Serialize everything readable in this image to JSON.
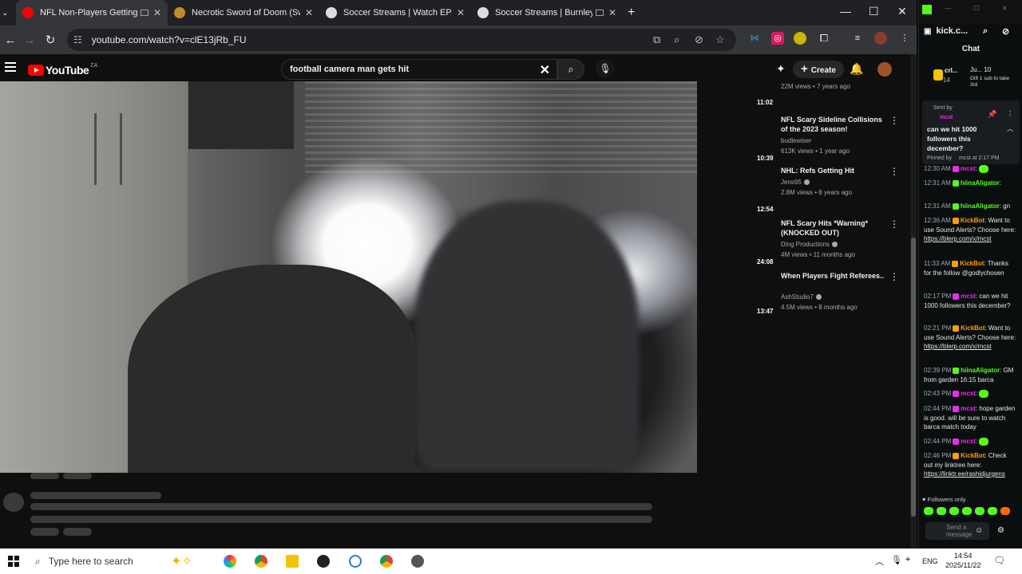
{
  "browser": {
    "tabs": [
      {
        "title": "NFL Non-Players Getting In",
        "active": true,
        "color": "#ff0000"
      },
      {
        "title": "Necrotic Sword of Doom (Swor",
        "active": false,
        "color": "#c28a2a"
      },
      {
        "title": "Soccer Streams | Watch EPL On",
        "active": false,
        "color": "#dddddd"
      },
      {
        "title": "Soccer Streams | Burnley vs",
        "active": false,
        "color": "#dddddd"
      }
    ],
    "url": "youtube.com/watch?v=clE13jRb_FU"
  },
  "youtube": {
    "logo_text": "YouTube",
    "logo_superscript": "ZA",
    "search_value": "football camera man gets hit",
    "create_label": "Create",
    "recommendations": [
      {
        "duration": "11:02",
        "title": "",
        "channel": "",
        "meta": "22M views • 7 years ago"
      },
      {
        "duration": "10:39",
        "title": "NFL Scary Sideline Collisions of the 2023 season!",
        "channel": "budlewiser",
        "meta": "613K views • 1 year ago"
      },
      {
        "duration": "12:54",
        "title": "NHL: Refs Getting Hit",
        "channel": "Jens95",
        "meta": "2.8M views • 8 years ago"
      },
      {
        "duration": "24:08",
        "title": "NFL Scary Hits *Warning* (KNOCKED OUT)",
        "channel": "Ding Productions",
        "meta": "4M views • 11 months ago"
      },
      {
        "duration": "13:47",
        "title": "When Players Fight Referees..",
        "channel": "AshStudio7",
        "meta": "4.5M views • 8 months ago"
      }
    ]
  },
  "kick": {
    "title": "kick.c...",
    "chat_label": "Chat",
    "top_user": "crl...",
    "top_user_count": "14",
    "gift_text": "Ju... 10",
    "gift_sub": "Gift 1 sub to take 3rd",
    "pinned": {
      "sent_by_label": "Sent by",
      "user": "mcst",
      "text": "can we hit 1000 followers this december?",
      "pinned_by": "Pinned by",
      "pinned_user": "mcst at 2:17 PM"
    },
    "messages": [
      {
        "time": "12:30 AM",
        "user": "mcst",
        "text": ":",
        "color": "#e62fe6",
        "emote": true
      },
      {
        "time": "12:31 AM",
        "user": "hiinaAligator",
        "text": ":",
        "color": "#53fc18",
        "emote": false
      },
      {
        "time": "12:31 AM",
        "user": "hiinaAligator",
        "text": ": gn",
        "color": "#53fc18",
        "emote": false
      },
      {
        "time": "12:36 AM",
        "user": "KickBot",
        "text": ": Want to use Sound Alerts? Choose here:",
        "link": "https://blerp.com/x/mcst",
        "color": "#ff9d00",
        "emote": false
      },
      {
        "time": "11:33 AM",
        "user": "KickBot",
        "text": ": Thanks for the follow @godlychosen",
        "color": "#ff9d00",
        "emote": false
      },
      {
        "time": "02:17 PM",
        "user": "mcst",
        "text": ": can we hit 1000 followers this december?",
        "color": "#e62fe6",
        "emote": false
      },
      {
        "time": "02:21 PM",
        "user": "KickBot",
        "text": ": Want to use Sound Alerts? Choose here:",
        "link": "https://blerp.com/x/mcst",
        "color": "#ff9d00",
        "emote": false
      },
      {
        "time": "02:39 PM",
        "user": "hiinaAligator",
        "text": ": GM from garden 16:15 barca",
        "color": "#53fc18",
        "emote": false
      },
      {
        "time": "02:43 PM",
        "user": "mcst",
        "text": ":",
        "color": "#e62fe6",
        "emote": true
      },
      {
        "time": "02:44 PM",
        "user": "mcst",
        "text": ": hope garden is good. will be sure to watch barca match today",
        "color": "#e62fe6",
        "emote": false
      },
      {
        "time": "02:44 PM",
        "user": "mcst",
        "text": ":",
        "color": "#e62fe6",
        "emote": true
      },
      {
        "time": "02:46 PM",
        "user": "KickBot",
        "text": ": Check out my linktree here:",
        "link": "https://linktr.ee/rashidjurgens",
        "color": "#ff9d00",
        "emote": false
      }
    ],
    "followers_only": "Followers only",
    "input_placeholder": "Send a message"
  },
  "taskbar": {
    "search_placeholder": "Type here to search",
    "lang": "ENG",
    "time": "14:54",
    "date": "2025/11/22"
  }
}
